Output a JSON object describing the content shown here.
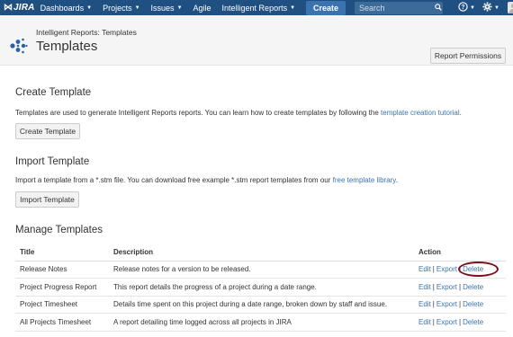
{
  "topnav": {
    "logo_text": "JIRA",
    "items": [
      {
        "label": "Dashboards",
        "has_caret": true
      },
      {
        "label": "Projects",
        "has_caret": true
      },
      {
        "label": "Issues",
        "has_caret": true
      },
      {
        "label": "Agile",
        "has_caret": false
      },
      {
        "label": "Intelligent Reports",
        "has_caret": true
      }
    ],
    "create_label": "Create",
    "search_placeholder": "Search",
    "help_icon": "help-icon",
    "settings_icon": "gear-icon",
    "bar_color": "#205081",
    "create_color": "#3b73af"
  },
  "header": {
    "breadcrumb": "Intelligent Reports: Templates",
    "title": "Templates",
    "report_permissions_label": "Report Permissions"
  },
  "create_section": {
    "heading": "Create Template",
    "desc_prefix": "Templates are used to generate Intelligent Reports reports. You can learn how to create templates by following the ",
    "desc_link": "template creation tutorial",
    "desc_suffix": ".",
    "button_label": "Create Template"
  },
  "import_section": {
    "heading": "Import Template",
    "desc_prefix": "Import a template from a *.stm file. You can download free example *.stm report templates from our ",
    "desc_link": "free template library",
    "desc_suffix": ".",
    "button_label": "Import Template"
  },
  "manage_section": {
    "heading": "Manage Templates",
    "columns": [
      "Title",
      "Description",
      "Action"
    ],
    "rows": [
      {
        "title": "Release Notes",
        "description": "Release notes for a version to be released."
      },
      {
        "title": "Project Progress Report",
        "description": "This report details the progress of a project during a date range."
      },
      {
        "title": "Project Timesheet",
        "description": "Details time spent on this project during a date range, broken down by staff and issue."
      },
      {
        "title": "All Projects Timesheet",
        "description": "A report detailing time logged across all projects in JIRA"
      }
    ],
    "actions": {
      "edit": "Edit",
      "export": "Export",
      "delete": "Delete",
      "separator": "|"
    },
    "link_color": "#3b73af",
    "highlight_color": "#7a1020"
  }
}
